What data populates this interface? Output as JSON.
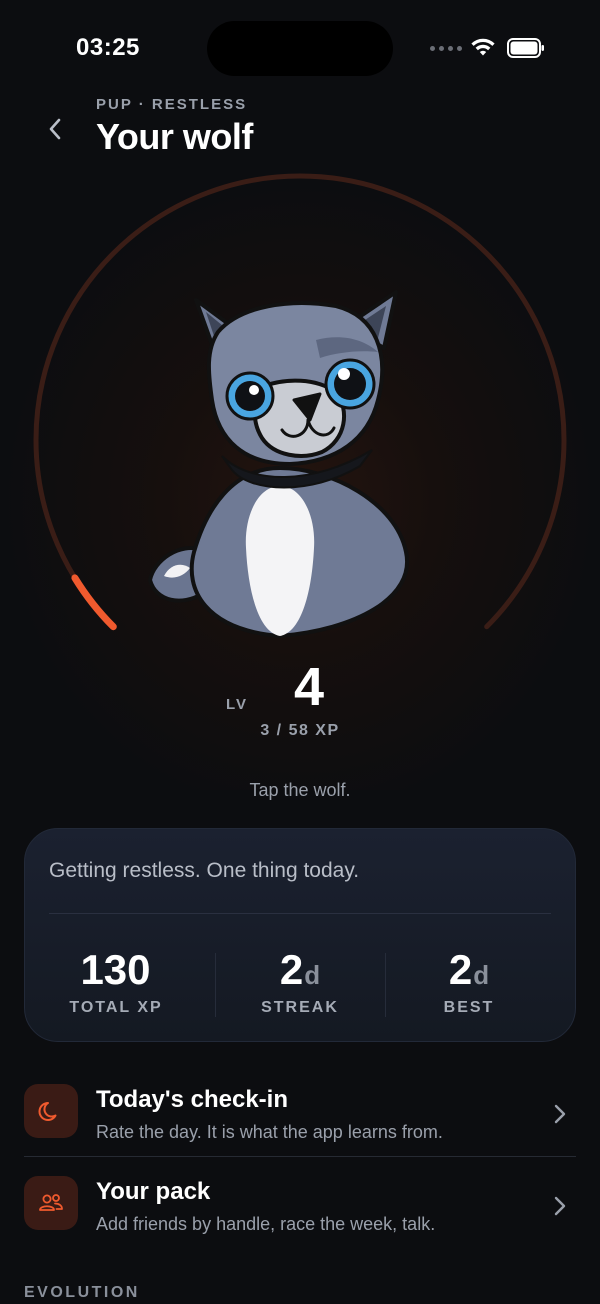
{
  "status": {
    "time": "03:25"
  },
  "header": {
    "eyebrow": "PUP · RESTLESS",
    "title": "Your wolf"
  },
  "level": {
    "label": "LV",
    "value": "4",
    "xp": "3 / 58 XP",
    "progress": 0.05
  },
  "hint": "Tap the wolf.",
  "card": {
    "message": "Getting restless. One thing today.",
    "stats": [
      {
        "value": "130",
        "unit": "",
        "label": "TOTAL XP"
      },
      {
        "value": "2",
        "unit": "d",
        "label": "STREAK"
      },
      {
        "value": "2",
        "unit": "d",
        "label": "BEST"
      }
    ]
  },
  "rows": [
    {
      "title": "Today's check-in",
      "subtitle": "Rate the day. It is what the app learns from.",
      "icon": "moon-icon"
    },
    {
      "title": "Your pack",
      "subtitle": "Add friends by handle, race the week, talk.",
      "icon": "people-icon"
    }
  ],
  "section_title": "EVOLUTION",
  "colors": {
    "accent": "#f05a2e",
    "ring_track": "#3a1d16",
    "icon_bg": "#3a1b15",
    "background": "#0c0d10"
  }
}
